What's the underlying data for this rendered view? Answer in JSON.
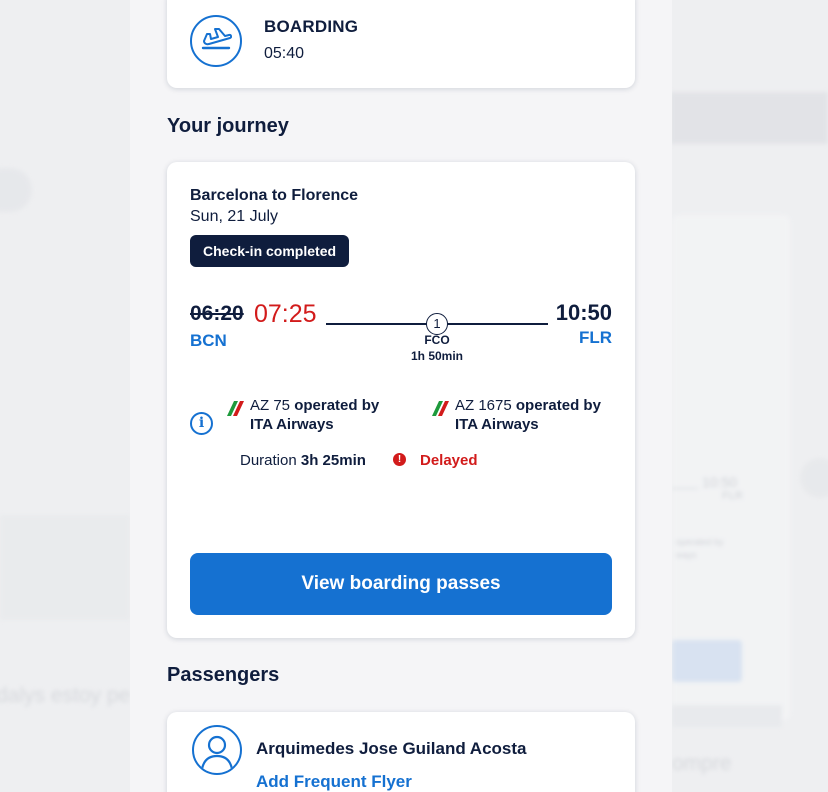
{
  "boarding": {
    "label": "BOARDING",
    "time": "05:40",
    "icon": "plane-departure-icon"
  },
  "journey": {
    "section_title": "Your journey",
    "route": "Barcelona to Florence",
    "date": "Sun, 21 July",
    "status_badge": "Check-in completed",
    "departure": {
      "scheduled_time": "06:20",
      "actual_time": "07:25",
      "airport": "BCN"
    },
    "arrival": {
      "time": "10:50",
      "airport": "FLR"
    },
    "stop": {
      "count": "1",
      "airport": "FCO",
      "layover": "1h 50min"
    },
    "flights": [
      {
        "number": "AZ 75",
        "operated_label": "operated by",
        "carrier": "ITA Airways"
      },
      {
        "number": "AZ 1675",
        "operated_label": "operated by",
        "carrier": "ITA Airways"
      }
    ],
    "duration_label": "Duration",
    "duration_value": "3h 25min",
    "delay_status": "Delayed",
    "cta_label": "View boarding passes"
  },
  "passengers": {
    "section_title": "Passengers",
    "items": [
      {
        "name": "Arquimedes Jose Guiland Acosta",
        "action": "Add Frequent Flyer"
      }
    ]
  },
  "background": {
    "time": "10:50",
    "code": "FLR",
    "small_text": "operated by\nways",
    "left_text": "dalys estoy pe",
    "right_text": "ompre"
  },
  "colors": {
    "navy": "#0f1d3d",
    "accent_blue": "#1571d1",
    "alert_red": "#d21b1b",
    "surface": "#ffffff",
    "sheet_bg": "#f5f5f7"
  }
}
